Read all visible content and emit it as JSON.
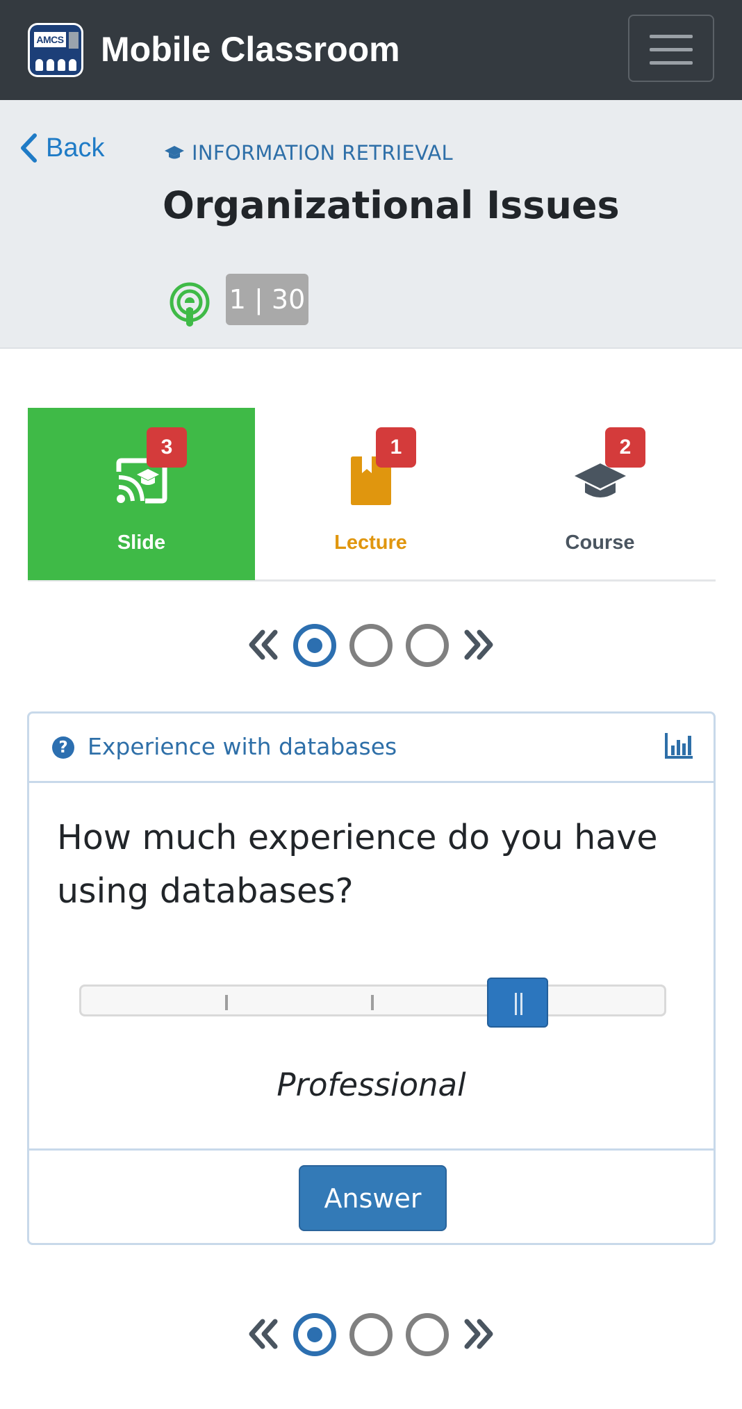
{
  "navbar": {
    "logo_text": "AMCS",
    "app_title": "Mobile Classroom",
    "menu_icon": "hamburger-icon"
  },
  "header": {
    "back_label": "Back",
    "course_icon": "graduation-cap-icon",
    "course_name": "INFORMATION RETRIEVAL",
    "page_title": "Organizational Issues",
    "broadcast_icon": "podcast-icon",
    "broadcast_color": "#3fba47",
    "slide_counter": "1 | 30"
  },
  "tabs": [
    {
      "label": "Slide",
      "badge": "3",
      "icon": "cast-icon",
      "active": true,
      "color": "#3fba47"
    },
    {
      "label": "Lecture",
      "badge": "1",
      "icon": "bookmark-icon",
      "active": false,
      "color": "#e0960e"
    },
    {
      "label": "Course",
      "badge": "2",
      "icon": "graduation-cap-icon",
      "active": false,
      "color": "#4a5560"
    }
  ],
  "pager": {
    "icons": [
      "double-chevron-left-icon",
      "double-chevron-right-icon"
    ],
    "pages": 3,
    "active_page": 1
  },
  "question_card": {
    "title": "Experience with databases",
    "help_icon": "question-circle-icon",
    "stats_icon": "bar-chart-icon",
    "question": "How much experience do you have using databases?",
    "slider": {
      "steps": 5,
      "selected_step": 4,
      "value_label": "Professional"
    },
    "answer_label": "Answer",
    "accent": "#337ab7"
  },
  "badge_color": "#d43b3b"
}
